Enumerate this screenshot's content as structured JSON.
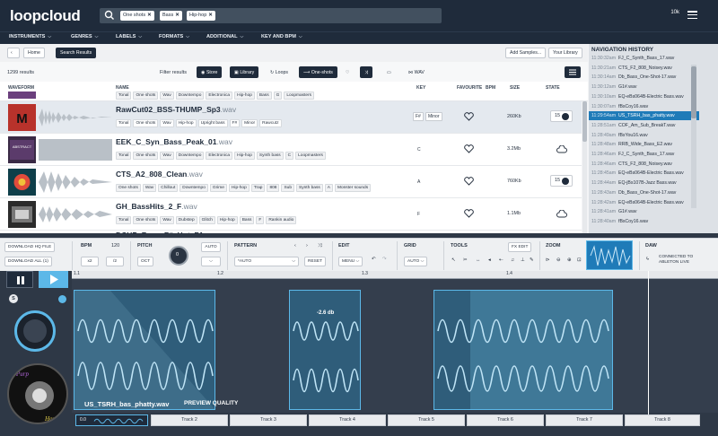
{
  "app": {
    "logo": "loopcloud",
    "credits": "10k"
  },
  "search": {
    "chips": [
      "One shots",
      "Bass",
      "Hip-hop"
    ]
  },
  "nav": [
    "INSTRUMENTS",
    "GENRES",
    "LABELS",
    "FORMATS",
    "ADDITIONAL",
    "KEY AND BPM"
  ],
  "toolbar": {
    "home": "Home",
    "search_results": "Search Results",
    "add_samples": "Add Samples...",
    "your_library": "Your Library"
  },
  "filters": {
    "results": "1299 results",
    "label": "Filter results",
    "store": "Store",
    "library": "Library",
    "loops": "Loops",
    "one_shots": "One-shots",
    "wav": "WAV"
  },
  "columns": {
    "waveform": "WAVEFORM",
    "name": "NAME",
    "key": "KEY",
    "favourite": "FAVOURITE",
    "bpm": "BPM",
    "size": "SIZE",
    "state": "STATE"
  },
  "top_tags": [
    "Tonal",
    "One shots",
    "Wav",
    "Downtempo",
    "Electronica",
    "Hip-hop",
    "Bass",
    "G",
    "Loopmasters"
  ],
  "rows": [
    {
      "name": "RawCut02_BSS-THUMP_Sp3",
      "ext": ".wav",
      "tags": [
        "Tonal",
        "One shots",
        "Wav",
        "Hip-hop",
        "Upright bass",
        "F#",
        "Minor",
        "Rawcutz"
      ],
      "key": "F#",
      "scale": "Minor",
      "size": "260Kb",
      "state": "15"
    },
    {
      "name": "EEK_C_Syn_Bass_Peak_01",
      "ext": ".wav",
      "tags": [
        "Tonal",
        "One shots",
        "Wav",
        "Downtempo",
        "Electronica",
        "Hip-hop",
        "Synth bass",
        "C",
        "Loopmasters"
      ],
      "key": "C",
      "scale": "",
      "size": "3.2Mb",
      "state": ""
    },
    {
      "name": "CTS_A2_808_Clean",
      "ext": ".wav",
      "tags": [
        "One shots",
        "Wav",
        "Chillout",
        "Downtempo",
        "Grime",
        "Hip-hop",
        "Trap",
        "808",
        "Sub",
        "Synth bass",
        "A",
        "Monster sounds"
      ],
      "key": "A",
      "scale": "",
      "size": "760Kb",
      "state": "15"
    },
    {
      "name": "GH_BassHits_2_F",
      "ext": ".wav",
      "tags": [
        "Tonal",
        "One shots",
        "Wav",
        "Dubstep",
        "Glitch",
        "Hip-hop",
        "Bass",
        "F",
        "Rankin audio"
      ],
      "key": "F",
      "scale": "",
      "size": "1.1Mb",
      "state": ""
    }
  ],
  "partial_row": "DCHP_Bass_F#_Hot_FA.wav",
  "history": {
    "title": "NAVIGATION HISTORY",
    "items": [
      {
        "time": "11:30:32am",
        "name": "FJ_C_Synth_Bass_17.wav"
      },
      {
        "time": "11:30:21am",
        "name": "CTS_F2_808_Noisey.wav"
      },
      {
        "time": "11:30:14am",
        "name": "Db_Bass_One-Shot-17.wav"
      },
      {
        "time": "11:30:12am",
        "name": "G1#.wav"
      },
      {
        "time": "11:30:10am",
        "name": "EQ-eBs064B-Electric Bass.wav"
      },
      {
        "time": "11:30:07am",
        "name": "fBsCoy16.wav"
      },
      {
        "time": "11:29:54am",
        "name": "US_TSRH_bas_phatty.wav"
      },
      {
        "time": "11:28:51am",
        "name": "COF_Am_Sub_BreakT.wav"
      },
      {
        "time": "11:28:49am",
        "name": "fBsYou16.wav"
      },
      {
        "time": "11:28:48am",
        "name": "RRB_Wide_Bass_E2.wav"
      },
      {
        "time": "11:28:46am",
        "name": "FJ_C_Synth_Bass_17.wav"
      },
      {
        "time": "11:28:46am",
        "name": "CTS_F2_808_Noisey.wav"
      },
      {
        "time": "11:28:45am",
        "name": "EQ-eBs064B-Electric Bass.wav"
      },
      {
        "time": "11:28:44am",
        "name": "EQ-jBs107B-Jazz Bass.wav"
      },
      {
        "time": "11:28:43am",
        "name": "Db_Bass_One-Shot-17.wav"
      },
      {
        "time": "11:28:42am",
        "name": "EQ-eBs064B-Electric Bass.wav"
      },
      {
        "time": "11:28:41am",
        "name": "G1#.wav"
      },
      {
        "time": "11:28:40am",
        "name": "fBsCoy16.wav"
      }
    ]
  },
  "daw_tools": {
    "download_file": "DOWNLOAD HQ FILE",
    "download_all": "DOWNLOAD ALL (1)",
    "bpm": "BPM",
    "bpm_value": "120",
    "x2": "x2",
    "half": "/2",
    "pitch": "PITCH",
    "pitch_auto": "AUTO",
    "oct": "OCT",
    "pitch_value": "0",
    "pattern": "PATTERN",
    "pattern_value": "*AUTO",
    "reset": "RESET",
    "edit": "EDIT",
    "menu": "MENU",
    "grid": "GRID",
    "grid_value": "AUTO",
    "tools": "TOOLS",
    "fx_edit": "FX EDIT",
    "zoom": "ZOOM",
    "daw": "DAW",
    "connected": "CONNECTED TO ABLETON LIVE"
  },
  "ruler": [
    "1.1",
    "1.2",
    "1.3",
    "1.4"
  ],
  "clip_db": "-2.6 db",
  "clip_name": "US_TSRH_bas_phatty.wav",
  "preview": "PREVIEW QUALITY",
  "mini_value": "0.0",
  "tracks": [
    "Track 2",
    "Track 3",
    "Track 4",
    "Track 5",
    "Track 6",
    "Track 7",
    "Track 8"
  ],
  "colors": {
    "navy": "#1f2b3b",
    "accent": "#1f7bb8",
    "wave": "#5cb8e8"
  }
}
